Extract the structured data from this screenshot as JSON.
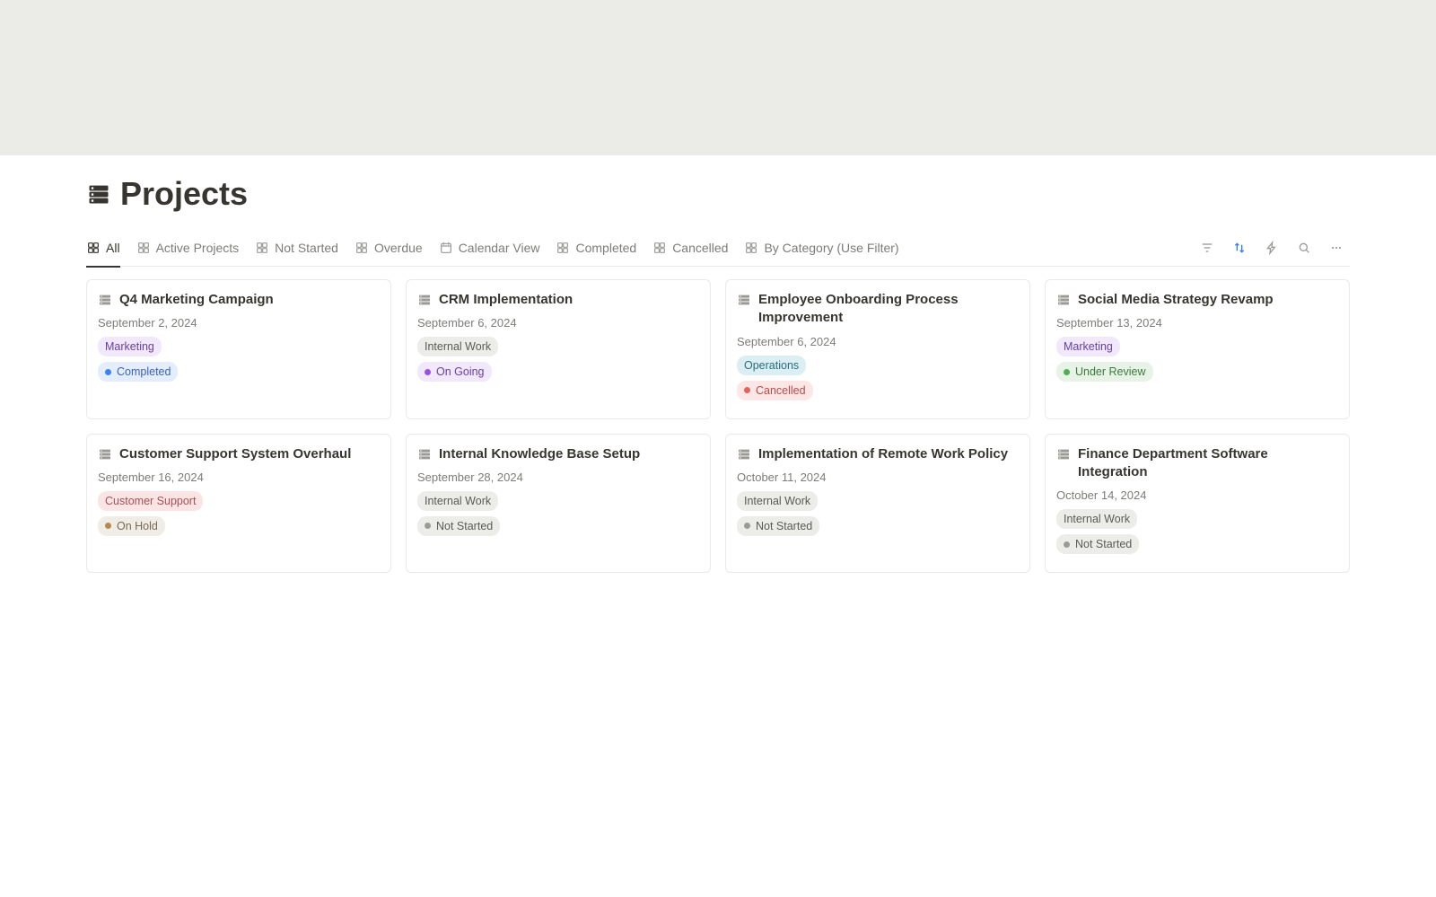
{
  "page": {
    "title": "Projects"
  },
  "tabs": [
    {
      "label": "All",
      "icon": "gallery",
      "active": true
    },
    {
      "label": "Active Projects",
      "icon": "gallery",
      "active": false
    },
    {
      "label": "Not Started",
      "icon": "gallery",
      "active": false
    },
    {
      "label": "Overdue",
      "icon": "gallery",
      "active": false
    },
    {
      "label": "Calendar View",
      "icon": "calendar",
      "active": false
    },
    {
      "label": "Completed",
      "icon": "gallery",
      "active": false
    },
    {
      "label": "Cancelled",
      "icon": "gallery",
      "active": false
    },
    {
      "label": "By Category (Use Filter)",
      "icon": "gallery",
      "active": false
    }
  ],
  "colors": {
    "marketing": {
      "bg": "#f1e8fb",
      "fg": "#6940a5"
    },
    "internal_work": {
      "bg": "#ecece9",
      "fg": "#5a5a55"
    },
    "operations": {
      "bg": "#dbeef3",
      "fg": "#2a6e7c"
    },
    "customer_support": {
      "bg": "#fbe4e4",
      "fg": "#a5505a"
    },
    "completed": {
      "bg": "#e4edfb",
      "fg": "#3a62b4",
      "dot": "#3b82f6"
    },
    "ongoing": {
      "bg": "#f1e8fb",
      "fg": "#6940a5",
      "dot": "#9b51e0"
    },
    "cancelled": {
      "bg": "#fde6e6",
      "fg": "#b94a48",
      "dot": "#e8605b"
    },
    "under_review": {
      "bg": "#e6f3e6",
      "fg": "#3d7a3d",
      "dot": "#4caf50"
    },
    "on_hold": {
      "bg": "#f0ece6",
      "fg": "#7a6a54",
      "dot": "#b58a52"
    },
    "not_started": {
      "bg": "#ecece9",
      "fg": "#5a5a55",
      "dot": "#9b9a97"
    }
  },
  "cards": [
    {
      "title": "Q4 Marketing Campaign",
      "date": "September 2, 2024",
      "category": {
        "label": "Marketing",
        "colorKey": "marketing"
      },
      "status": {
        "label": "Completed",
        "colorKey": "completed"
      }
    },
    {
      "title": "CRM Implementation",
      "date": "September 6, 2024",
      "category": {
        "label": "Internal Work",
        "colorKey": "internal_work"
      },
      "status": {
        "label": "On Going",
        "colorKey": "ongoing"
      }
    },
    {
      "title": "Employee Onboarding Process Improvement",
      "date": "September 6, 2024",
      "category": {
        "label": "Operations",
        "colorKey": "operations"
      },
      "status": {
        "label": "Cancelled",
        "colorKey": "cancelled"
      }
    },
    {
      "title": "Social Media Strategy Revamp",
      "date": "September 13, 2024",
      "category": {
        "label": "Marketing",
        "colorKey": "marketing"
      },
      "status": {
        "label": "Under Review",
        "colorKey": "under_review"
      }
    },
    {
      "title": "Customer Support System Overhaul",
      "date": "September 16, 2024",
      "category": {
        "label": "Customer Support",
        "colorKey": "customer_support"
      },
      "status": {
        "label": "On Hold",
        "colorKey": "on_hold"
      }
    },
    {
      "title": "Internal Knowledge Base Setup",
      "date": "September 28, 2024",
      "category": {
        "label": "Internal Work",
        "colorKey": "internal_work"
      },
      "status": {
        "label": "Not Started",
        "colorKey": "not_started"
      }
    },
    {
      "title": "Implementation of Remote Work Policy",
      "date": "October 11, 2024",
      "category": {
        "label": "Internal Work",
        "colorKey": "internal_work"
      },
      "status": {
        "label": "Not Started",
        "colorKey": "not_started"
      }
    },
    {
      "title": "Finance Department Software Integration",
      "date": "October 14, 2024",
      "category": {
        "label": "Internal Work",
        "colorKey": "internal_work"
      },
      "status": {
        "label": "Not Started",
        "colorKey": "not_started"
      }
    }
  ]
}
